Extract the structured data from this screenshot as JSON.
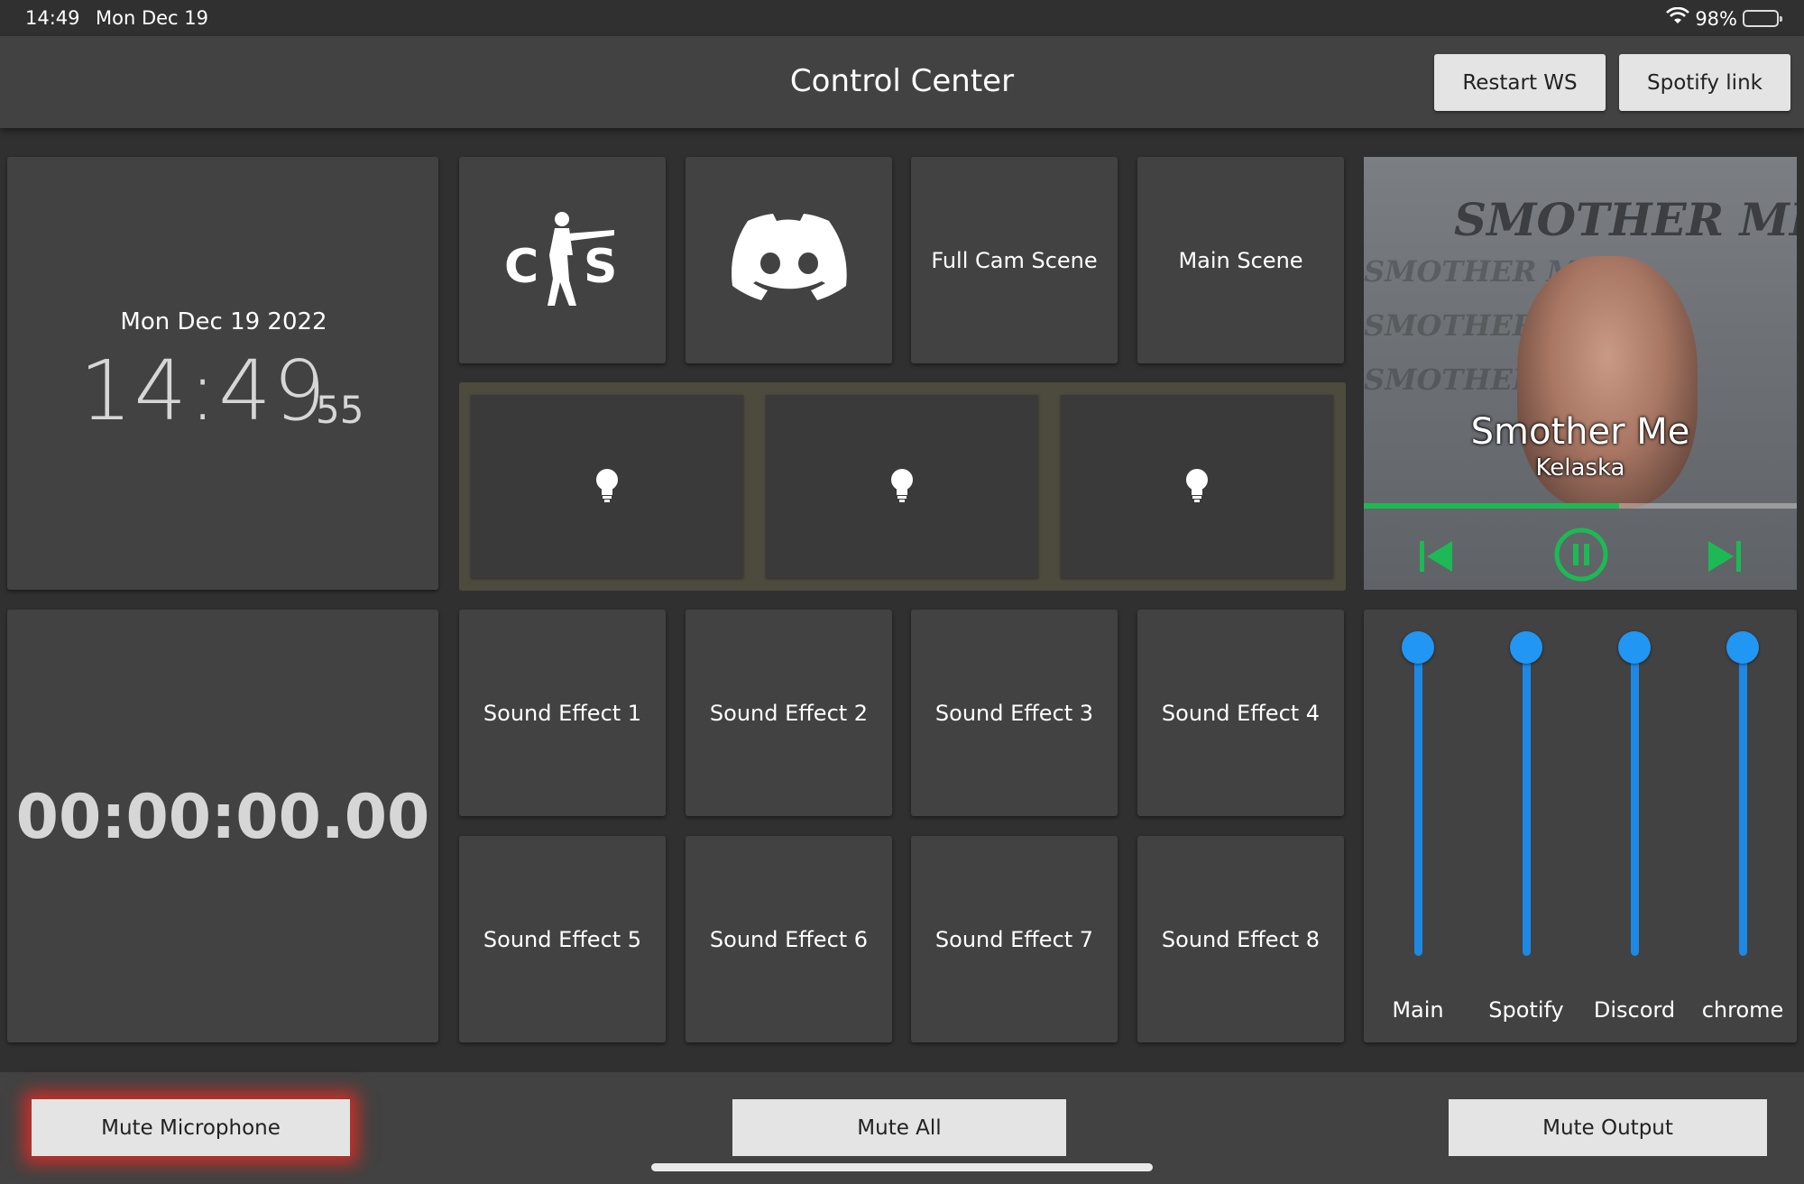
{
  "status_bar": {
    "time": "14:49",
    "date": "Mon Dec 19",
    "battery": "98%",
    "battery_level": 0.98
  },
  "header": {
    "title": "Control Center",
    "restart_label": "Restart WS",
    "spotify_label": "Spotify link"
  },
  "clock": {
    "date": "Mon Dec 19 2022",
    "hours_minutes": "14:49",
    "seconds": "55"
  },
  "stopwatch": {
    "value": "00:00:00.00"
  },
  "scene_buttons": {
    "cs_icon": "cs-logo-icon",
    "discord_icon": "discord-logo-icon",
    "full_cam": "Full Cam Scene",
    "main_scene": "Main Scene"
  },
  "lights": [
    {
      "icon": "lightbulb-icon"
    },
    {
      "icon": "lightbulb-icon"
    },
    {
      "icon": "lightbulb-icon"
    }
  ],
  "sound_effects": [
    "Sound Effect 1",
    "Sound Effect 2",
    "Sound Effect 3",
    "Sound Effect 4",
    "Sound Effect 5",
    "Sound Effect 6",
    "Sound Effect 7",
    "Sound Effect 8"
  ],
  "player": {
    "cover_text": "SMOTHER ME",
    "song_title": "Smother Me",
    "artist": "Kelaska",
    "progress": 0.59,
    "accent_color": "#1db954",
    "controls": [
      "skip-previous-icon",
      "pause-circle-icon",
      "skip-next-icon"
    ]
  },
  "mixer": {
    "accent_color": "#2196f3",
    "channels": [
      {
        "label": "Main",
        "level": 1.0
      },
      {
        "label": "Spotify",
        "level": 1.0
      },
      {
        "label": "Discord",
        "level": 1.0
      },
      {
        "label": "chrome",
        "level": 1.0
      }
    ]
  },
  "footer": {
    "mute_mic": "Mute Microphone",
    "mute_all": "Mute All",
    "mute_output": "Mute Output",
    "mic_muted_glow": "#ff2a1e"
  }
}
